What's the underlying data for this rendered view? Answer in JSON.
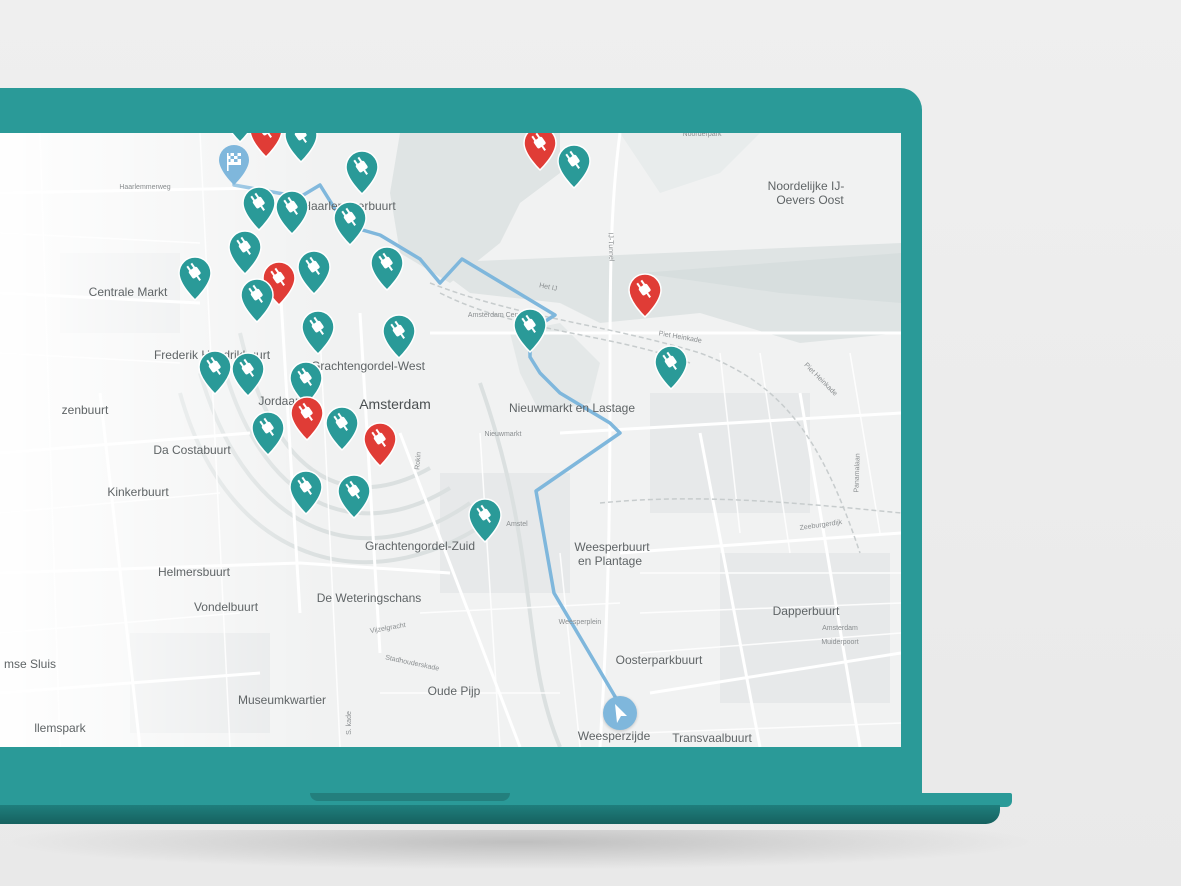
{
  "colors": {
    "device": "#2a9a98",
    "available_pin": "#2a9a98",
    "occupied_pin": "#e03c36",
    "route": "#7fb7dc",
    "water": "#dfe4e4",
    "map_bg": "#f1f2f2"
  },
  "map": {
    "labels": {
      "noordelijke_1": "Noordelijke IJ-",
      "noordelijke_2": "Oevers Oost",
      "haarlemmerbuurt": "Haarlemmerbuurt",
      "centrale_markt": "Centrale Markt",
      "frederik_hendrikbuurt": "Frederik Hendrikbuurt",
      "grachtengordel_west": "Grachtengordel-West",
      "jordaan": "Jordaan",
      "amsterdam": "Amsterdam",
      "nieuwmarkt_lastage": "Nieuwmarkt en Lastage",
      "zenbuurt": "zenbuurt",
      "da_costabuurt": "Da Costabuurt",
      "kinkerbuurt": "Kinkerbuurt",
      "grachtengordel_zuid": "Grachtengordel-Zuid",
      "weesperbuurt_1": "Weesperbuurt",
      "weesperbuurt_2": "en Plantage",
      "helmersbuurt": "Helmersbuurt",
      "vondelbuurt": "Vondelbuurt",
      "de_weteringschans": "De Weteringschans",
      "dapperbuurt": "Dapperbuurt",
      "oosterparkbuurt": "Oosterparkbuurt",
      "mse_sluis": "mse Sluis",
      "oude_pijp": "Oude Pijp",
      "museumkwartier": "Museumkwartier",
      "llemspark": "llemspark",
      "weesperzijde": "Weesperzijde",
      "transvaalbuurt": "Transvaalbuurt"
    },
    "street_labels": {
      "noorderpark": "Noorderpark",
      "ij_tunnel": "IJ-Tunnel",
      "het_ij": "Het IJ",
      "piet_heinkade": "Piet Heinkade",
      "piet_heinkade_2": "Piet Heinkade",
      "amsterdam_centraal": "Amsterdam Centraal",
      "haarlemmerweg": "Haarlemmerweg",
      "nieuwmarkt": "Nieuwmarkt",
      "rokin": "Rokin",
      "amstel": "Amstel",
      "vijzelgracht": "Vijzelgracht",
      "stadhouderskade": "Stadhouderskade",
      "weesperplein": "Weesperplein",
      "panamalaan": "Panamalaan",
      "zeeburgerdijk": "Zeeburgerdijk",
      "amsterdam_muiderpoort": "Amsterdam Muiderpoort",
      "s_kade": "S. kade"
    },
    "markers": [
      {
        "type": "occupied",
        "status_icon": "plug-icon"
      },
      {
        "type": "available",
        "status_icon": "plug-icon"
      }
    ],
    "route": {
      "start_icon": "navigation-arrow-icon",
      "end_icon": "checkered-flag-icon"
    }
  }
}
